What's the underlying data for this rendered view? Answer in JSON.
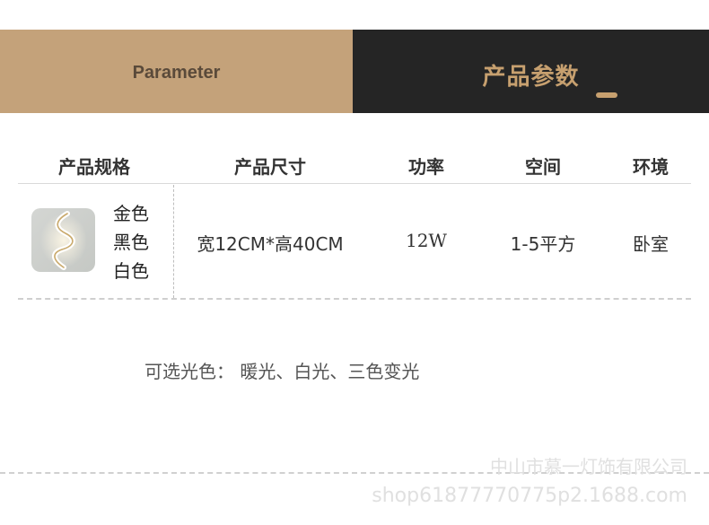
{
  "banner": {
    "left_label": "Parameter",
    "right_label": "产品参数",
    "left_color": "#c4a27a",
    "right_color": "#252525",
    "accent_color": "#c7a06f"
  },
  "table": {
    "headers": [
      "产品规格",
      "产品尺寸",
      "功率",
      "空间",
      "环境"
    ],
    "row": {
      "colors": [
        "金色",
        "黑色",
        "白色"
      ],
      "size": "宽12CM*高40CM",
      "power": "12W",
      "space": "1-5平方",
      "environment": "卧室"
    }
  },
  "optional_light": "可选光色：  暖光、白光、三色变光",
  "watermark": {
    "company": "中山市慕一灯饰有限公司",
    "shop": "shop61877770775p2.1688.com"
  }
}
